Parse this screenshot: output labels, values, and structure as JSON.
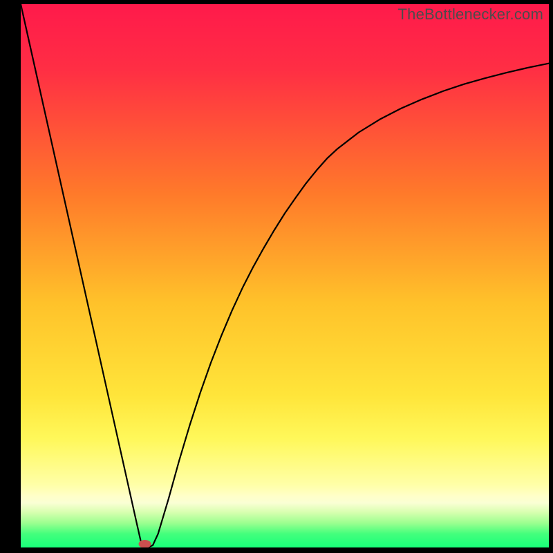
{
  "watermark": "TheBottlenecker.com",
  "colors": {
    "top": "#ff1a4b",
    "mid_upper": "#ff6a2a",
    "mid": "#ffc92a",
    "mid_lower": "#ffef3a",
    "pale_yellow": "#ffff8a",
    "green": "#18ff7a",
    "curve": "#000000",
    "marker": "#cc4f4f",
    "frame_bg": "#000000"
  },
  "chart_data": {
    "type": "line",
    "title": "",
    "xlabel": "",
    "ylabel": "",
    "xlim": [
      0,
      100
    ],
    "ylim": [
      0,
      100
    ],
    "x": [
      0,
      2,
      4,
      6,
      8,
      10,
      12,
      14,
      16,
      18,
      20,
      22,
      23,
      24,
      25,
      26,
      28,
      30,
      32,
      34,
      36,
      38,
      40,
      42,
      44,
      46,
      48,
      50,
      52,
      54,
      56,
      58,
      60,
      64,
      68,
      72,
      76,
      80,
      84,
      88,
      92,
      96,
      100
    ],
    "y": [
      100,
      91.3,
      82.6,
      73.9,
      65.2,
      56.5,
      47.8,
      39.1,
      30.4,
      21.7,
      13.0,
      4.3,
      0.0,
      0.0,
      0.4,
      2.5,
      9.0,
      16.0,
      22.5,
      28.5,
      34.0,
      39.0,
      43.6,
      47.8,
      51.6,
      55.1,
      58.4,
      61.5,
      64.3,
      67.0,
      69.4,
      71.6,
      73.4,
      76.4,
      78.8,
      80.8,
      82.5,
      84.0,
      85.3,
      86.4,
      87.4,
      88.3,
      89.1
    ],
    "marker": {
      "x": 23.5,
      "y": 0.0
    },
    "gradient_stops": [
      {
        "pos": 0.0,
        "color": "#ff1a4b"
      },
      {
        "pos": 0.12,
        "color": "#ff2e44"
      },
      {
        "pos": 0.35,
        "color": "#ff7a2a"
      },
      {
        "pos": 0.55,
        "color": "#ffc22a"
      },
      {
        "pos": 0.72,
        "color": "#ffe53a"
      },
      {
        "pos": 0.8,
        "color": "#fff85a"
      },
      {
        "pos": 0.885,
        "color": "#ffffa8"
      },
      {
        "pos": 0.905,
        "color": "#ffffc8"
      },
      {
        "pos": 0.918,
        "color": "#faffd4"
      },
      {
        "pos": 0.935,
        "color": "#d8ffb0"
      },
      {
        "pos": 0.955,
        "color": "#9cff90"
      },
      {
        "pos": 0.975,
        "color": "#43ff7c"
      },
      {
        "pos": 1.0,
        "color": "#18ff7a"
      }
    ]
  }
}
